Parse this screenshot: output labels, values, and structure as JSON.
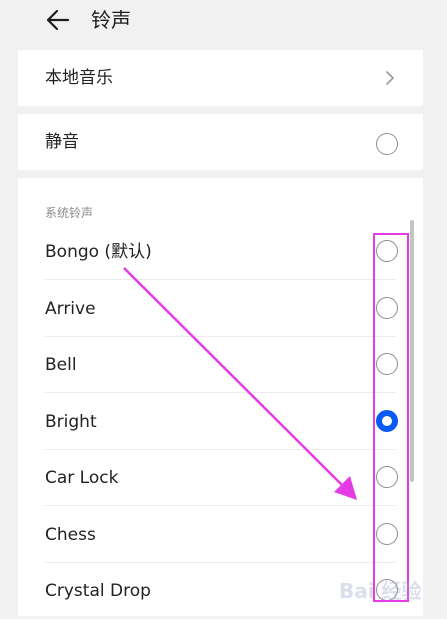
{
  "header": {
    "title": "铃声",
    "back_icon": "arrow-left-icon"
  },
  "local_music": {
    "label": "本地音乐",
    "icon": "chevron-right-icon"
  },
  "silent": {
    "label": "静音",
    "selected": false
  },
  "system_ringtones": {
    "header": "系统铃声",
    "items": [
      {
        "label": "Bongo (默认)",
        "selected": false
      },
      {
        "label": "Arrive",
        "selected": false
      },
      {
        "label": "Bell",
        "selected": false
      },
      {
        "label": "Bright",
        "selected": true
      },
      {
        "label": "Car Lock",
        "selected": false
      },
      {
        "label": "Chess",
        "selected": false
      },
      {
        "label": "Crystal Drop",
        "selected": false
      }
    ]
  },
  "colors": {
    "accent": "#0a59f7",
    "annotation": "#e53be5"
  },
  "watermark": {
    "text": "Bai 经验"
  }
}
